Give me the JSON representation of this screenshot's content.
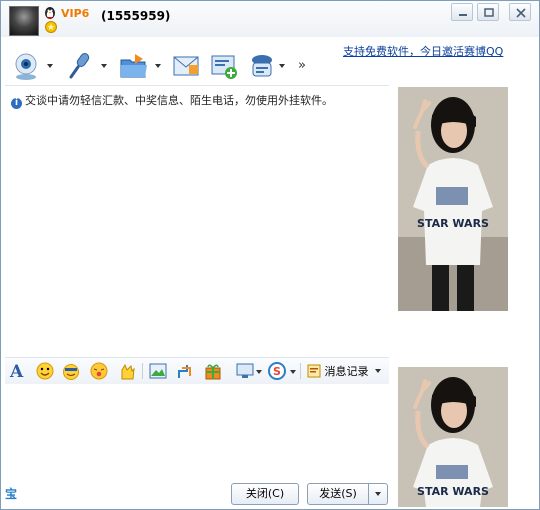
{
  "titlebar": {
    "vip_badge": "VIP6",
    "qq_number": "(1555959)"
  },
  "window_controls": {
    "minimize": "minimize",
    "maximize": "maximize",
    "close": "close"
  },
  "promo_link": "支持免费软件，今日邀活赛博QQ",
  "toolbar": {
    "items": [
      "video-chat-icon",
      "voice-chat-icon",
      "send-file-icon",
      "email-icon",
      "share-icon",
      "app-icon"
    ],
    "more": "»"
  },
  "message_pane": {
    "warning": "交谈中请勿轻信汇款、中奖信息、陌生电话，勿使用外挂软件。"
  },
  "format_bar": {
    "history_label": "消息记录"
  },
  "footer": {
    "bao_label": "宝",
    "close_button": "关闭(C)",
    "send_button": "发送(S)"
  },
  "photo_caption": "STAR WARS",
  "colors": {
    "accent": "#2e6dbe",
    "border": "#7f9db9",
    "vip": "#f07a00"
  }
}
